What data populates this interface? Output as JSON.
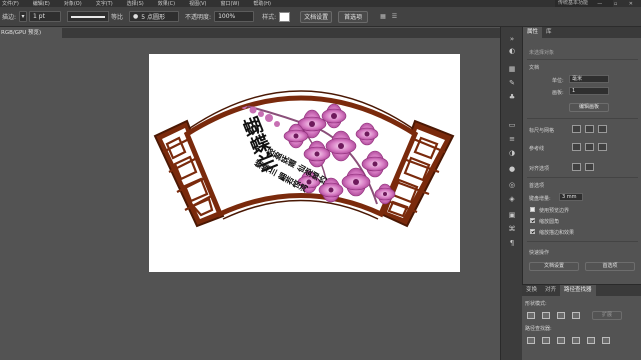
{
  "menubar": {
    "items": [
      "文件(F)",
      "编辑(E)",
      "对象(O)",
      "文字(T)",
      "选择(S)",
      "效果(C)",
      "视图(V)",
      "窗口(W)",
      "帮助(H)"
    ],
    "workspace": "传统基本功能",
    "window_buttons": "— ▫ ✕"
  },
  "controlbar": {
    "stroke_label": "描边:",
    "stroke_weight": "1 pt",
    "stroke_profile": "等比",
    "brush": "5 点圆形",
    "opacity_label": "不透明度:",
    "opacity_value": "100%",
    "style_label": "样式:",
    "doc_setup_button": "文档设置",
    "preferences_button": "首选项"
  },
  "document": {
    "tab_label": "RGB/GPU 预览)"
  },
  "artwork": {
    "title": "蝴蝶兰",
    "subtitle_1": "轻盈妩媚 仙姿绰约",
    "subtitle_2": "蝴蝶兰 翩若惊鸿"
  },
  "properties_panel": {
    "tabs": [
      "属性",
      "库"
    ],
    "no_selection": "未选择对象",
    "section_document": "文档",
    "units_label": "单位:",
    "units_value": "毫米",
    "artboard_label": "画板:",
    "artboard_value": "1",
    "edit_artboard_button": "编辑画板",
    "rulers_label": "标尺与网格",
    "guides_label": "参考线",
    "align_label": "对齐选项",
    "preferences_label": "首选项",
    "keyboard_increment_label": "键盘增量:",
    "keyboard_increment_value": "3 mm",
    "use_preview_bounds": "使用预览边界",
    "scale_corners": "缩放圆角",
    "scale_strokes_effects": "缩放描边和效果",
    "quick_actions": "快速操作",
    "doc_setup_button": "文档设置",
    "preferences_button": "首选项"
  },
  "pathfinder_panel": {
    "tabs": [
      "变换",
      "对齐",
      "路径查找器"
    ],
    "shape_modes_label": "形状模式:",
    "expand_button": "扩展",
    "pathfinders_label": "路径查找器:"
  },
  "colors": {
    "frame_brown": "#7a2a0c",
    "frame_dark": "#4a1804",
    "petal_pink": "#d77bc3",
    "petal_dark": "#8e2b78",
    "stem_color": "#8a4f79",
    "ui_dark": "#323232",
    "ui_mid": "#535353"
  }
}
